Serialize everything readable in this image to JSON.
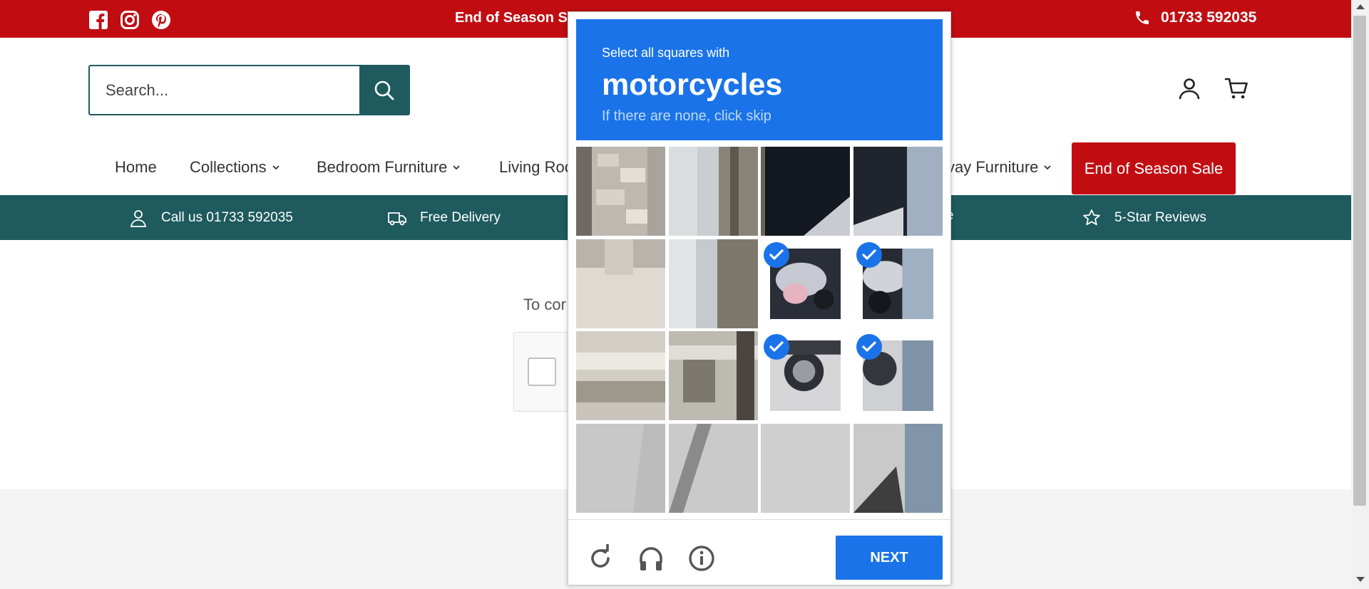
{
  "topbar": {
    "promo": "End of Season Sa",
    "phone": "01733 592035",
    "social": [
      "facebook-icon",
      "instagram-icon",
      "pinterest-icon"
    ],
    "bg_color": "#c10d12"
  },
  "search": {
    "placeholder": "Search..."
  },
  "nav": {
    "items": [
      "Home",
      "Collections",
      "Bedroom Furniture",
      "Living Roo",
      "vay Furniture"
    ],
    "sale_label": "End of Season Sale"
  },
  "infobar": {
    "items": [
      {
        "icon": "user-icon",
        "label": "Call us 01733 592035"
      },
      {
        "icon": "truck-icon",
        "label": "Free Delivery"
      },
      {
        "icon": "store-icon",
        "label": "ore"
      },
      {
        "icon": "star-icon",
        "label": "5-Star Reviews"
      }
    ],
    "bg_color": "#1e5a5e"
  },
  "main": {
    "verify_text": "To cor"
  },
  "captcha": {
    "instruction": "Select all squares with",
    "object": "motorcycles",
    "skip_hint": "If there are none, click skip",
    "next_label": "NEXT",
    "selected_tiles": [
      6,
      7,
      10,
      11
    ],
    "accent_color": "#1a73e8",
    "footer_icons": [
      "reload-icon",
      "headphones-icon",
      "info-icon"
    ]
  }
}
